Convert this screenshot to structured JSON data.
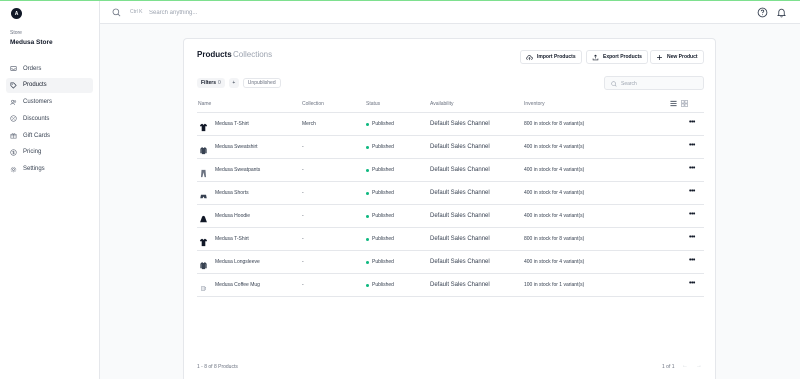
{
  "sidebar": {
    "logo_letter": "A",
    "store_label": "Store",
    "store_name": "Medusa Store",
    "items": [
      {
        "label": "Orders",
        "icon": "inbox-icon"
      },
      {
        "label": "Products",
        "icon": "tag-icon",
        "active": true
      },
      {
        "label": "Customers",
        "icon": "users-icon"
      },
      {
        "label": "Discounts",
        "icon": "percent-icon"
      },
      {
        "label": "Gift Cards",
        "icon": "gift-icon"
      },
      {
        "label": "Pricing",
        "icon": "currency-icon"
      },
      {
        "label": "Settings",
        "icon": "gear-icon"
      }
    ]
  },
  "topbar": {
    "shortcut": "Ctrl K",
    "search_placeholder": "Search anything..."
  },
  "tabs": {
    "products": "Products",
    "collections": "Collections"
  },
  "actions": {
    "import": "Import Products",
    "export": "Export Products",
    "new": "New Product"
  },
  "filters": {
    "label": "Filters",
    "count": "0",
    "plus": "+",
    "unpublished": "Unpublished"
  },
  "table_search": {
    "placeholder": "Search"
  },
  "table": {
    "headers": {
      "name": "Name",
      "collection": "Collection",
      "status": "Status",
      "availability": "Availability",
      "inventory": "Inventory"
    },
    "rows": [
      {
        "name": "Medusa T-Shirt",
        "collection": "Merch",
        "status": "Published",
        "availability": "Default Sales Channel",
        "inventory": "800 in stock for 8 variant(s)",
        "thumb": "tshirt"
      },
      {
        "name": "Medusa Sweatshirt",
        "collection": "-",
        "status": "Published",
        "availability": "Default Sales Channel",
        "inventory": "400 in stock for 4 variant(s)",
        "thumb": "sweatshirt"
      },
      {
        "name": "Medusa Sweatpants",
        "collection": "-",
        "status": "Published",
        "availability": "Default Sales Channel",
        "inventory": "400 in stock for 4 variant(s)",
        "thumb": "pants"
      },
      {
        "name": "Medusa Shorts",
        "collection": "-",
        "status": "Published",
        "availability": "Default Sales Channel",
        "inventory": "400 in stock for 4 variant(s)",
        "thumb": "shorts"
      },
      {
        "name": "Medusa Hoodie",
        "collection": "-",
        "status": "Published",
        "availability": "Default Sales Channel",
        "inventory": "400 in stock for 4 variant(s)",
        "thumb": "hoodie"
      },
      {
        "name": "Medusa T-Shirt",
        "collection": "-",
        "status": "Published",
        "availability": "Default Sales Channel",
        "inventory": "800 in stock for 8 variant(s)",
        "thumb": "tshirt"
      },
      {
        "name": "Medusa Longsleeve",
        "collection": "-",
        "status": "Published",
        "availability": "Default Sales Channel",
        "inventory": "400 in stock for 4 variant(s)",
        "thumb": "sweatshirt"
      },
      {
        "name": "Medusa Coffee Mug",
        "collection": "-",
        "status": "Published",
        "availability": "Default Sales Channel",
        "inventory": "100 in stock for 1 variant(s)",
        "thumb": "mug"
      }
    ],
    "more_label": "•••"
  },
  "pagination": {
    "summary": "1 - 8 of 8 Products",
    "pages": "1 of 1",
    "prev": "←",
    "next": "→"
  },
  "colors": {
    "published_dot": "#10b981",
    "accent_topline": "#7ee08f"
  }
}
